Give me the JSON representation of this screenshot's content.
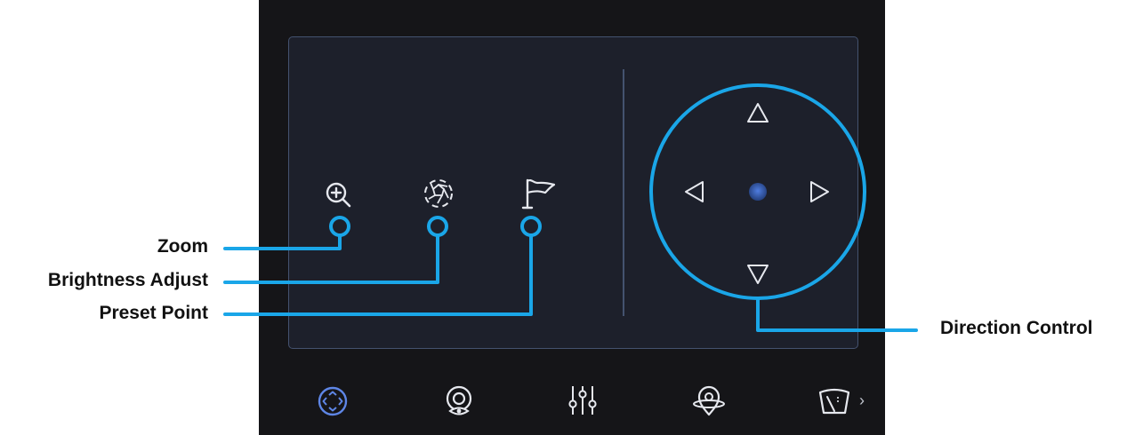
{
  "annotations": {
    "zoom": "Zoom",
    "brightness": "Brightness Adjust",
    "preset": "Preset Point",
    "direction": "Direction Control"
  },
  "toolbar": {
    "icons": [
      "ptz-icon",
      "camera-eye-icon",
      "sliders-icon",
      "location-pin-icon",
      "wiper-icon"
    ],
    "active_index": 0,
    "more": "›"
  },
  "colors": {
    "device_bg": "#151518",
    "panel_bg": "#1d202b",
    "panel_border": "#44526f",
    "icon": "#e6e8ee",
    "accent": "#2f6fd0",
    "callout": "#1aa6e8"
  }
}
